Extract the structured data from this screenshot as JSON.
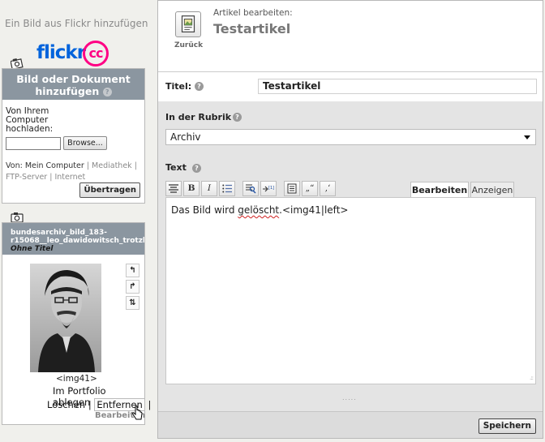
{
  "sidebar": {
    "flickr_link": "Ein Bild aus Flickr hinzufügen",
    "flickr_logo": {
      "word": "flickr",
      "cc": "cc"
    },
    "upload": {
      "heading": "Bild oder Dokument hinzufügen",
      "help_icon": "?",
      "file_label": "Von Ihrem Computer hochladen:",
      "file_value": "",
      "browse_label": "Browse...",
      "source_prefix": "Von:",
      "source_current": "Mein Computer",
      "source_separator": "|",
      "source_mediathek": "Mediathek",
      "source_ftp": "FTP-Server",
      "source_internet": "Internet",
      "transfer_label": "Übertragen"
    },
    "image": {
      "filename_line1": "bundesarchiv_bild_183-",
      "filename_line2": "r15068__leo_dawidowitsch_trotzki.j",
      "subtitle": "Ohne Titel",
      "tag": "<img41>",
      "portfolio": "Im Portfolio ablegen",
      "delete": "Löschen",
      "separator": "|",
      "remove": "Entfernen",
      "edit": "Bearbeiten"
    }
  },
  "article": {
    "back_label": "Zurück",
    "caption": "Artikel bearbeiten:",
    "title": "Testartikel",
    "title_label": "Titel:",
    "title_value": "Testartikel",
    "rubrik_label": "In der Rubrik",
    "rubrik_value": "Archiv",
    "text_label": "Text",
    "toolbar": {
      "bold": "B",
      "italic": "I",
      "quote_double": "„“",
      "quote_single": "‚‘"
    },
    "tabs": {
      "edit": "Bearbeiten",
      "view": "Anzeigen"
    },
    "editor_before": "Das Bild wird ",
    "editor_wavy": "gelöscht",
    "editor_after": ".<img41|left>",
    "save_label": "Speichern"
  },
  "icons": {
    "help": "question-circle-icon",
    "upload": "camera-upload-icon",
    "back": "document-back-icon",
    "rotate_left": "rotate-left-icon",
    "rotate_right": "rotate-right-icon",
    "flip": "flip-icon"
  },
  "colors": {
    "panel_header": "#8b96a0",
    "flickr_blue": "#0063dc",
    "flickr_pink": "#ff0084",
    "section_bg": "#e4e4e4"
  }
}
